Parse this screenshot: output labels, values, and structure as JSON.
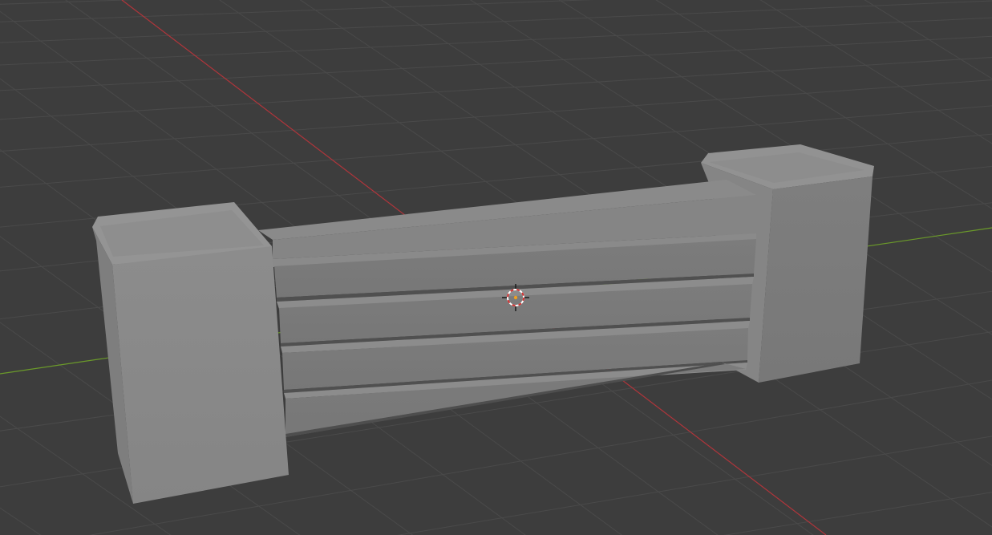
{
  "viewport": {
    "background_color": "#3d3d3d",
    "grid_color": "#4a4a4a",
    "x_axis_color": "#b0353b",
    "y_axis_color": "#6b9a2a"
  },
  "scene": {
    "object": "fence-segment",
    "object_color": "#8a8a8a",
    "plank_count": 4
  },
  "cursor": {
    "icon": "3d-cursor-icon",
    "ring_colors": [
      "#d23232",
      "#ffffff"
    ]
  }
}
